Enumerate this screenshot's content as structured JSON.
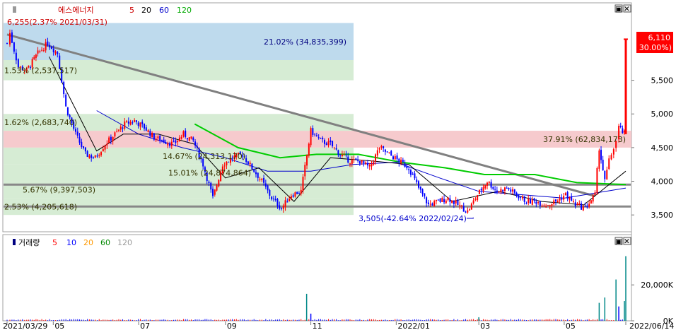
{
  "price_panel": {
    "legend_name": "에스에너지",
    "legend_ma_labels": [
      "5",
      "20",
      "60",
      "120"
    ],
    "legend_ma_colors": [
      "#ff0000",
      "#000000",
      "#0000ff",
      "#00cc00"
    ],
    "max_annotation": "6,255(2.37% 2021/03/31)",
    "min_annotation": "3,505(-42.64% 2022/02/24)",
    "last_price_label": "6,110",
    "last_change_label": "( 30.00%)"
  },
  "volume_panel": {
    "legend_name": "거래량",
    "legend_ma_labels": [
      "5",
      "10",
      "20",
      "60",
      "120"
    ],
    "legend_ma_colors": [
      "#ff0000",
      "#0000ff",
      "#ff9900",
      "#008800",
      "#aaaaaa"
    ]
  },
  "ui": {
    "panel_buttons": [
      "▣",
      "✕"
    ]
  },
  "colors": {
    "up": "#ff0000",
    "down": "#0000ff",
    "trendline": "#808080",
    "ma120": "#00cc00",
    "ma60": "#0000cc",
    "ma20": "#000000",
    "zone_blue": "#b3d4ea",
    "zone_red": "#f4c1c4",
    "zone_green": "#c8e6c6"
  },
  "chart_data": [
    {
      "type": "candlestick",
      "title": "에스에너지",
      "y_ticks": [
        "5,500",
        "5,000",
        "4,500",
        "4,000",
        "3,500"
      ],
      "y_tick_values": [
        5500,
        5000,
        4500,
        4000,
        3500
      ],
      "ylim": [
        3250,
        6650
      ],
      "x_tick_labels": [
        "2021/03/29",
        "05",
        "07",
        "09",
        "11",
        "2022/01",
        "03",
        "05",
        "2022/06/14"
      ],
      "x_tick_dates": [
        "2021-03-29",
        "2021-05-01",
        "2021-07-01",
        "2021-09-01",
        "2021-11-01",
        "2022-01-01",
        "2022-03-01",
        "2022-05-01",
        "2022-06-14"
      ],
      "xlim": [
        "2021-03-29",
        "2022-06-14"
      ],
      "max_point": {
        "date": "2021-03-31",
        "price": 6255,
        "change_pct": 2.37
      },
      "min_point": {
        "date": "2022-02-24",
        "price": 3505,
        "change_pct": -42.64
      },
      "last_price": 6110,
      "last_change_pct": 30.0,
      "volume_profile": [
        {
          "label": "21.02% (34,835,399)",
          "low": 5800,
          "high": 6350,
          "highlight": "blue"
        },
        {
          "label": "37.91% (62,834,173)",
          "low": 4500,
          "high": 4750,
          "highlight": "red"
        },
        {
          "label": "14.67% (24,313,170)",
          "low": 4250,
          "high": 4500
        },
        {
          "label": "15.01% (24,874,864)",
          "low": 4000,
          "high": 4250
        },
        {
          "label": "1.62% (2,683,740)",
          "low": 4750,
          "high": 5000
        },
        {
          "label": "1.53% (2,537,517)",
          "low": 5500,
          "high": 5800
        },
        {
          "label": "5.67% (9,397,503)",
          "low": 3750,
          "high": 4000
        },
        {
          "label": "2.53% (4,205,618)",
          "low": 3500,
          "high": 3750
        }
      ],
      "horizontal_lines": [
        3950,
        3625
      ],
      "trendline": {
        "from": {
          "date": "2021-03-29",
          "price": 6180
        },
        "to": {
          "date": "2022-05-23",
          "price": 3780
        }
      },
      "close_path": [
        [
          "2021-03-29",
          6050
        ],
        [
          "2021-03-31",
          6200
        ],
        [
          "2021-04-06",
          5700
        ],
        [
          "2021-04-12",
          5650
        ],
        [
          "2021-04-20",
          5900
        ],
        [
          "2021-04-27",
          6050
        ],
        [
          "2021-05-04",
          5900
        ],
        [
          "2021-05-10",
          5100
        ],
        [
          "2021-05-17",
          4700
        ],
        [
          "2021-05-24",
          4400
        ],
        [
          "2021-05-31",
          4350
        ],
        [
          "2021-06-07",
          4550
        ],
        [
          "2021-06-14",
          4700
        ],
        [
          "2021-06-21",
          4850
        ],
        [
          "2021-06-28",
          4900
        ],
        [
          "2021-07-05",
          4800
        ],
        [
          "2021-07-12",
          4650
        ],
        [
          "2021-07-19",
          4600
        ],
        [
          "2021-07-26",
          4550
        ],
        [
          "2021-08-02",
          4700
        ],
        [
          "2021-08-09",
          4600
        ],
        [
          "2021-08-16",
          4250
        ],
        [
          "2021-08-23",
          3750
        ],
        [
          "2021-08-30",
          4250
        ],
        [
          "2021-09-06",
          4350
        ],
        [
          "2021-09-13",
          4400
        ],
        [
          "2021-09-20",
          4200
        ],
        [
          "2021-09-27",
          4000
        ],
        [
          "2021-10-04",
          3750
        ],
        [
          "2021-10-11",
          3600
        ],
        [
          "2021-10-18",
          3800
        ],
        [
          "2021-10-25",
          3850
        ],
        [
          "2021-11-01",
          4750
        ],
        [
          "2021-11-08",
          4600
        ],
        [
          "2021-11-15",
          4550
        ],
        [
          "2021-11-22",
          4400
        ],
        [
          "2021-11-29",
          4300
        ],
        [
          "2021-12-06",
          4300
        ],
        [
          "2021-12-13",
          4200
        ],
        [
          "2021-12-20",
          4500
        ],
        [
          "2021-12-27",
          4400
        ],
        [
          "2022-01-03",
          4300
        ],
        [
          "2022-01-10",
          4200
        ],
        [
          "2022-01-17",
          3900
        ],
        [
          "2022-01-24",
          3650
        ],
        [
          "2022-01-31",
          3700
        ],
        [
          "2022-02-07",
          3750
        ],
        [
          "2022-02-14",
          3650
        ],
        [
          "2022-02-21",
          3550
        ],
        [
          "2022-02-28",
          3800
        ],
        [
          "2022-03-07",
          4000
        ],
        [
          "2022-03-14",
          3850
        ],
        [
          "2022-03-21",
          3900
        ],
        [
          "2022-03-28",
          3800
        ],
        [
          "2022-04-04",
          3700
        ],
        [
          "2022-04-11",
          3700
        ],
        [
          "2022-04-18",
          3650
        ],
        [
          "2022-04-25",
          3700
        ],
        [
          "2022-05-02",
          3800
        ],
        [
          "2022-05-09",
          3650
        ],
        [
          "2022-05-16",
          3600
        ],
        [
          "2022-05-23",
          3800
        ],
        [
          "2022-05-26",
          4500
        ],
        [
          "2022-05-30",
          4000
        ],
        [
          "2022-06-02",
          4300
        ],
        [
          "2022-06-07",
          4600
        ],
        [
          "2022-06-09",
          4800
        ],
        [
          "2022-06-13",
          4700
        ],
        [
          "2022-06-14",
          6110
        ]
      ],
      "ma120_path": [
        [
          "2021-08-10",
          4850
        ],
        [
          "2021-09-10",
          4500
        ],
        [
          "2021-10-10",
          4350
        ],
        [
          "2021-11-05",
          4400
        ],
        [
          "2021-12-05",
          4400
        ],
        [
          "2022-01-05",
          4280
        ],
        [
          "2022-02-05",
          4200
        ],
        [
          "2022-03-05",
          4100
        ],
        [
          "2022-04-10",
          4100
        ],
        [
          "2022-05-10",
          3980
        ],
        [
          "2022-06-14",
          3950
        ]
      ],
      "ma60_path": [
        [
          "2021-06-01",
          5050
        ],
        [
          "2021-07-01",
          4700
        ],
        [
          "2021-08-01",
          4500
        ],
        [
          "2021-09-01",
          4350
        ],
        [
          "2021-10-01",
          4150
        ],
        [
          "2021-11-01",
          4150
        ],
        [
          "2021-12-01",
          4250
        ],
        [
          "2022-01-01",
          4280
        ],
        [
          "2022-02-01",
          4050
        ],
        [
          "2022-03-01",
          3850
        ],
        [
          "2022-04-01",
          3800
        ],
        [
          "2022-05-01",
          3750
        ],
        [
          "2022-06-14",
          3900
        ]
      ],
      "ma20_path": [
        [
          "2021-04-28",
          5850
        ],
        [
          "2021-05-15",
          5150
        ],
        [
          "2021-06-01",
          4450
        ],
        [
          "2021-06-20",
          4700
        ],
        [
          "2021-07-15",
          4700
        ],
        [
          "2021-08-10",
          4550
        ],
        [
          "2021-09-01",
          4050
        ],
        [
          "2021-09-25",
          4200
        ],
        [
          "2021-10-20",
          3700
        ],
        [
          "2021-11-15",
          4350
        ],
        [
          "2021-12-15",
          4300
        ],
        [
          "2022-01-10",
          4250
        ],
        [
          "2022-02-10",
          3700
        ],
        [
          "2022-03-15",
          3850
        ],
        [
          "2022-04-15",
          3700
        ],
        [
          "2022-05-15",
          3650
        ],
        [
          "2022-06-14",
          4150
        ]
      ]
    },
    {
      "type": "bar",
      "title": "거래량",
      "y_ticks": [
        "20,000K",
        "0K"
      ],
      "y_tick_values": [
        20000,
        0
      ],
      "ylim": [
        0,
        48000
      ],
      "spikes": [
        [
          "2021-10-29",
          15000
        ],
        [
          "2021-11-01",
          4000
        ],
        [
          "2022-03-01",
          2000
        ],
        [
          "2022-05-26",
          10000
        ],
        [
          "2022-05-30",
          13000
        ],
        [
          "2022-06-07",
          23000
        ],
        [
          "2022-06-09",
          8000
        ],
        [
          "2022-06-13",
          11000
        ],
        [
          "2022-06-14",
          36000
        ]
      ]
    }
  ]
}
